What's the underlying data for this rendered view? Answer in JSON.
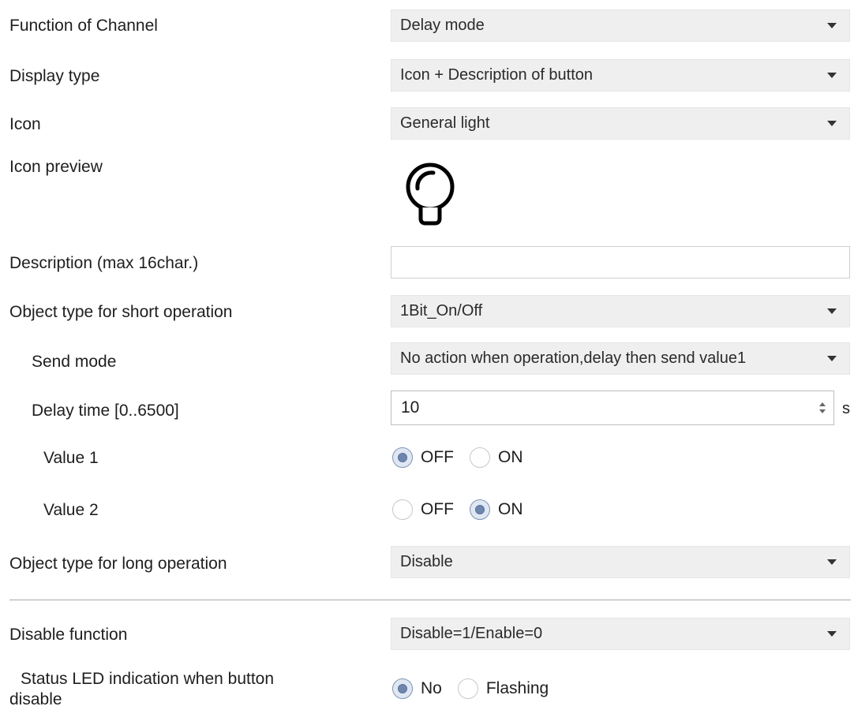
{
  "rows": {
    "function_of_channel": {
      "label": "Function of Channel",
      "value": "Delay mode"
    },
    "display_type": {
      "label": "Display type",
      "value": "Icon + Description of button"
    },
    "icon": {
      "label": "Icon",
      "value": "General light"
    },
    "icon_preview": {
      "label": "Icon preview",
      "icon": "light-bulb-icon"
    },
    "description": {
      "label": "Description (max 16char.)",
      "value": ""
    },
    "short_object_type": {
      "label": "Object type for short operation",
      "value": "1Bit_On/Off"
    },
    "send_mode": {
      "label": "Send mode",
      "value": "No action when operation,delay then send value1"
    },
    "delay_time": {
      "label": "Delay time [0..6500]",
      "value": "10",
      "unit": "s"
    },
    "value1": {
      "label": "Value 1",
      "options": [
        "OFF",
        "ON"
      ],
      "selected": "OFF"
    },
    "value2": {
      "label": "Value 2",
      "options": [
        "OFF",
        "ON"
      ],
      "selected": "ON"
    },
    "long_object_type": {
      "label": "Object type for long operation",
      "value": "Disable"
    },
    "disable_function": {
      "label": "Disable function",
      "value": "Disable=1/Enable=0"
    },
    "status_led": {
      "label_line1": "Status LED indication when button",
      "label_line2": "disable",
      "options": [
        "No",
        "Flashing"
      ],
      "selected": "No"
    }
  },
  "colors": {
    "select_bg": "#efefef",
    "radio_checked": "#6e86ad",
    "divider": "#a9a9a9"
  }
}
